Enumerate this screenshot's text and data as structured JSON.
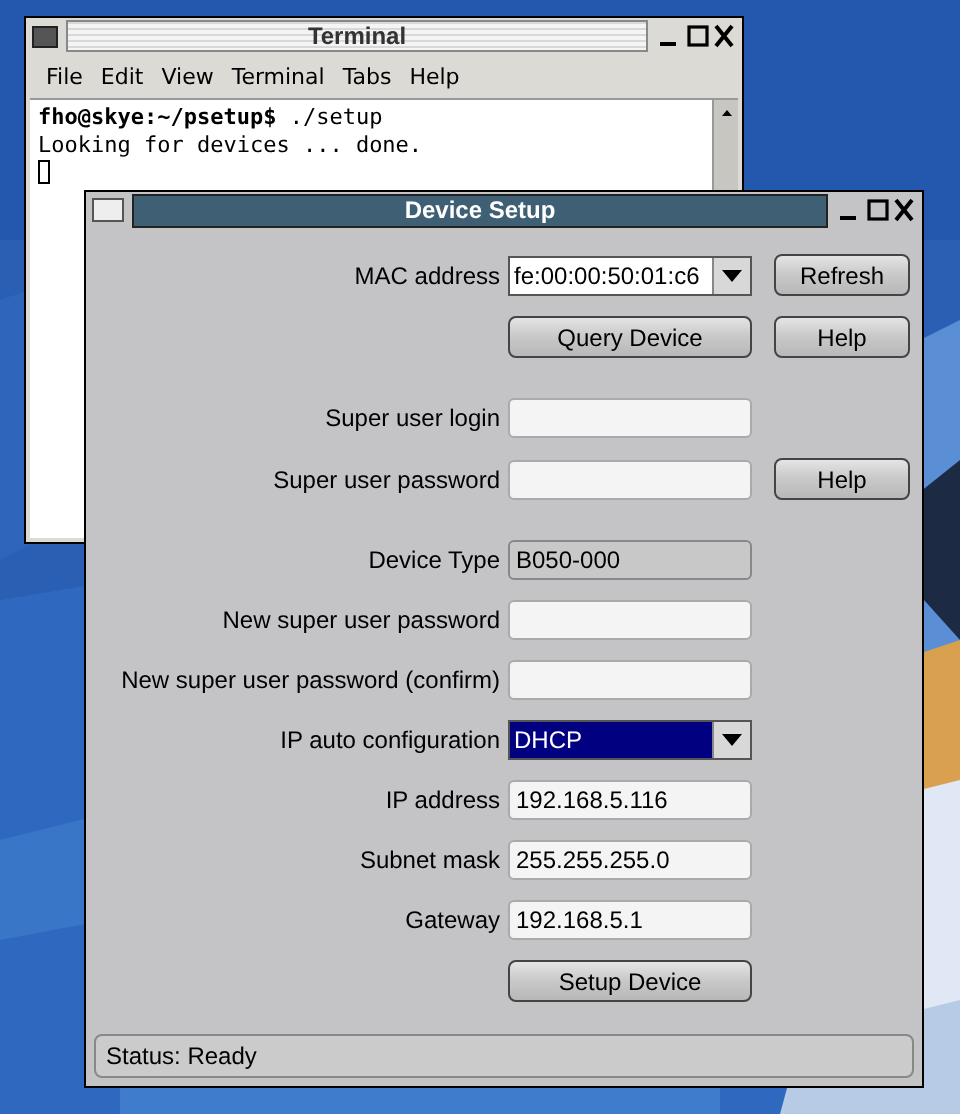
{
  "terminal": {
    "title": "Terminal",
    "menu": [
      "File",
      "Edit",
      "View",
      "Terminal",
      "Tabs",
      "Help"
    ],
    "lines": [
      "**fho@skye:~/psetup$** ./setup",
      "Looking for devices ... done."
    ]
  },
  "dialog": {
    "title": "Device Setup",
    "sections": [
      [
        {
          "kind": "combo",
          "label": "MAC address",
          "value": "fe:00:00:50:01:c6",
          "focused": false,
          "button": "Refresh"
        },
        {
          "kind": "button",
          "label": "Query Device",
          "button": "Help"
        }
      ],
      [
        {
          "kind": "text",
          "label": "Super user login"
        },
        {
          "kind": "text",
          "label": "Super user password",
          "button": "Help"
        }
      ],
      [
        {
          "kind": "readonly",
          "label": "Device Type",
          "value": "B050-000"
        },
        {
          "kind": "text",
          "label": "New super user password"
        },
        {
          "kind": "text",
          "label": "New super user password (confirm)"
        },
        {
          "kind": "combo",
          "label": "IP auto configuration",
          "value": "DHCP",
          "focused": true
        },
        {
          "kind": "text",
          "label": "IP address",
          "value": "192.168.5.116"
        },
        {
          "kind": "text",
          "label": "Subnet mask",
          "value": "255.255.255.0"
        },
        {
          "kind": "text",
          "label": "Gateway",
          "value": "192.168.5.1"
        },
        {
          "kind": "button",
          "label": "Setup Device"
        }
      ]
    ],
    "status": "Status: Ready"
  }
}
